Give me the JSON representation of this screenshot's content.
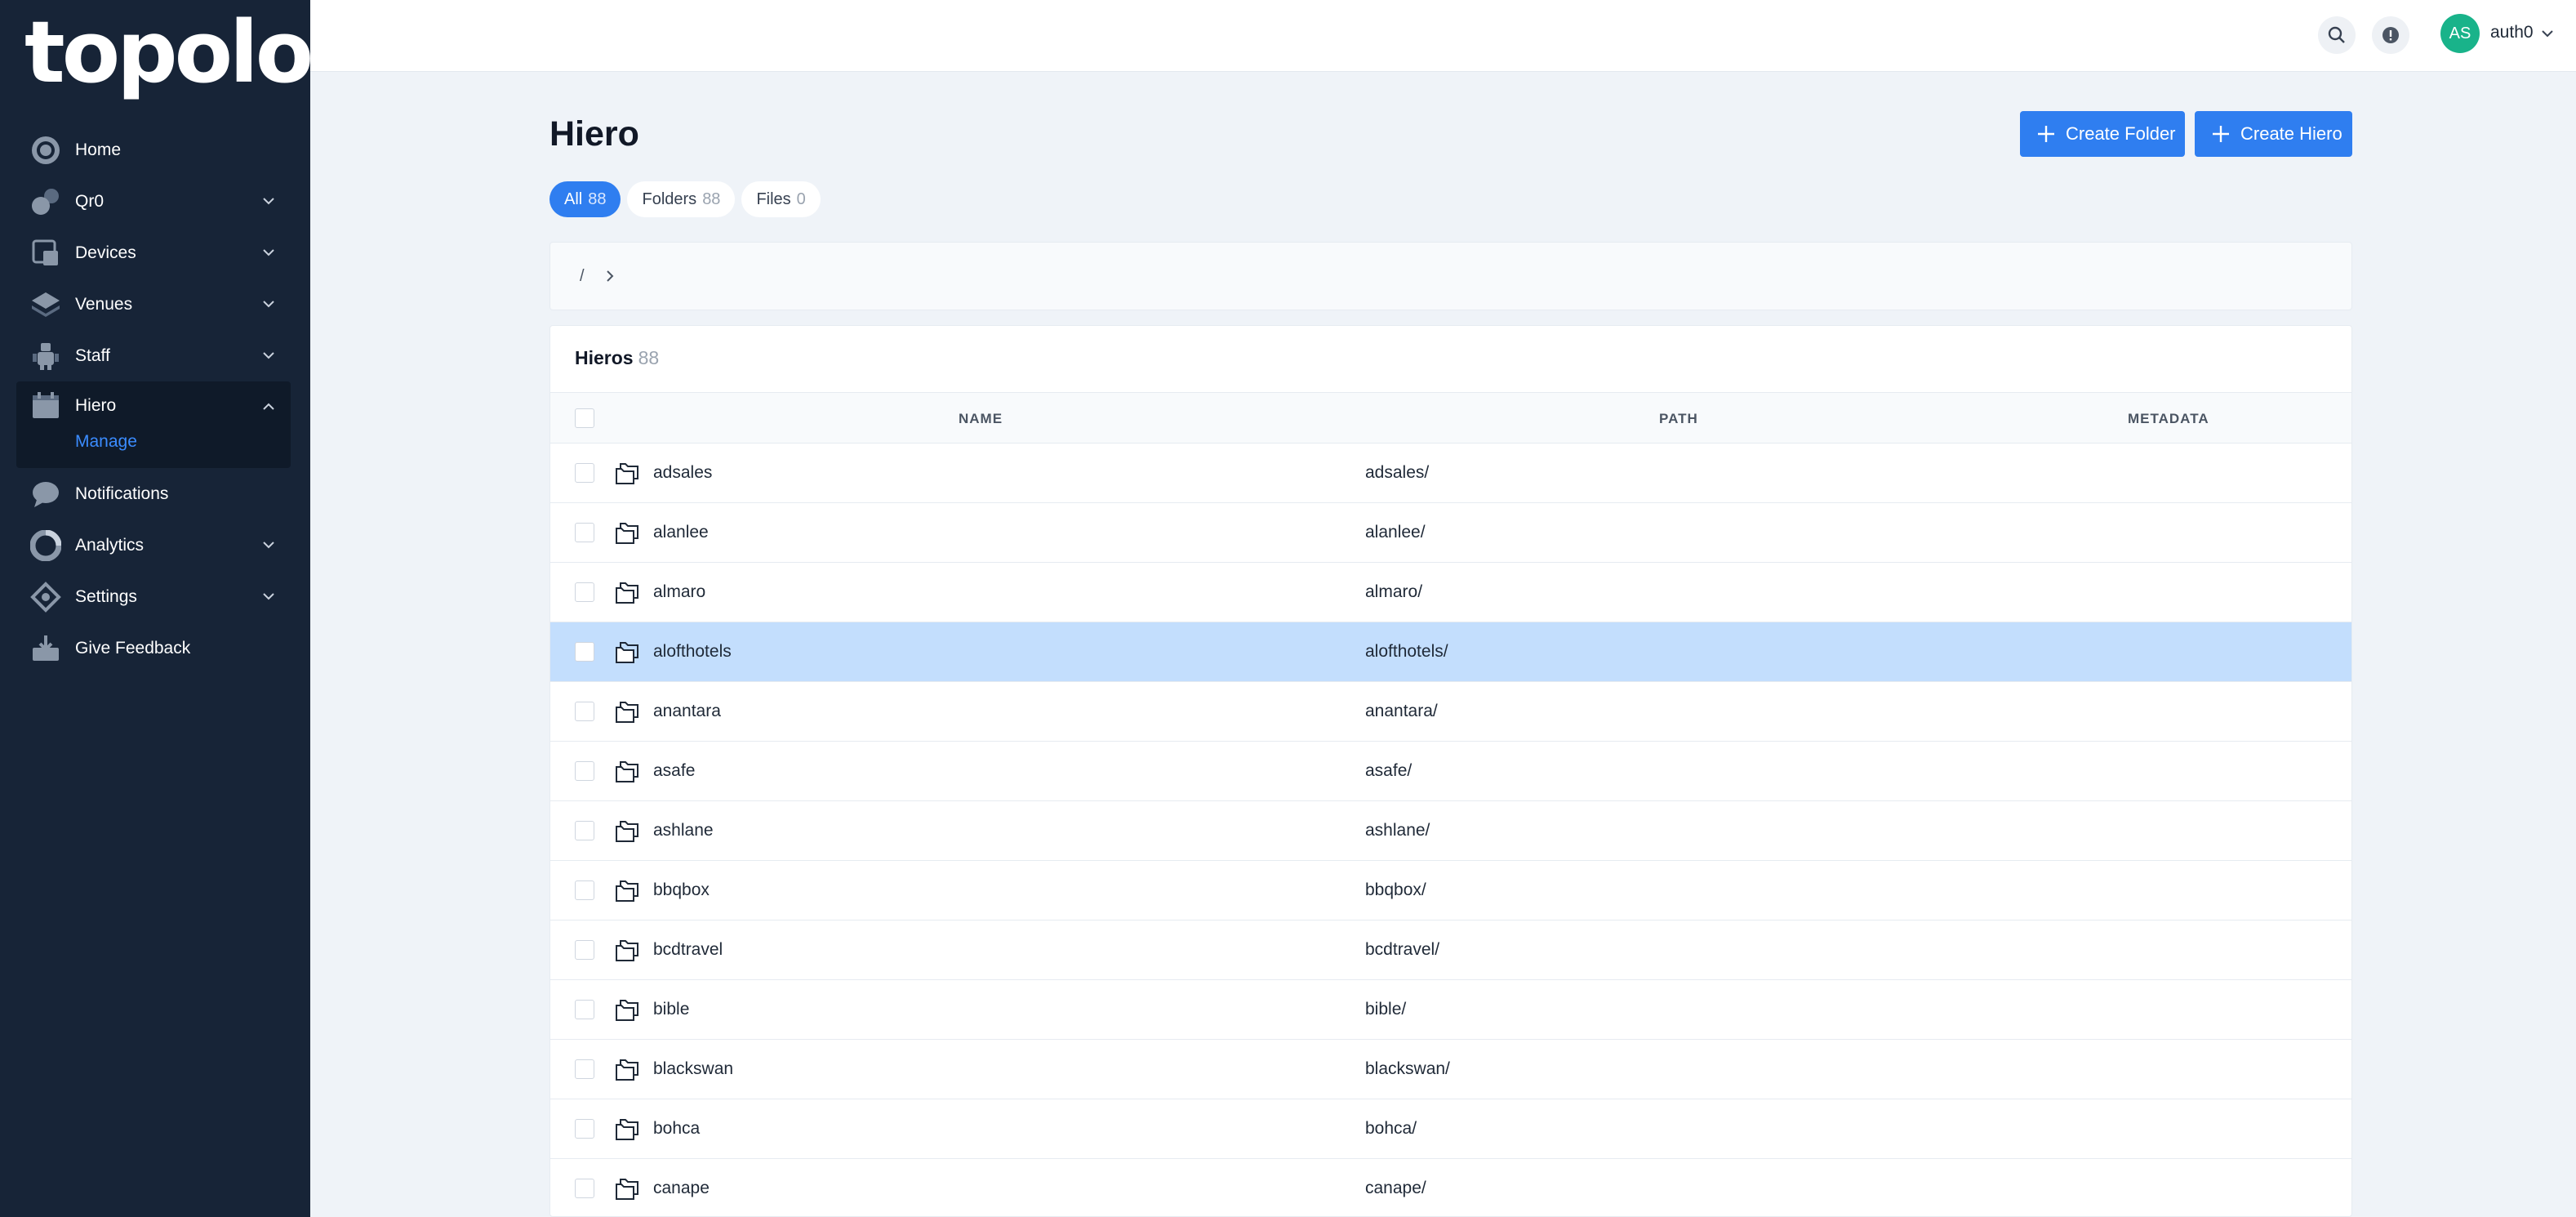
{
  "brand": {
    "logo_text": "topolo"
  },
  "sidebar": {
    "items": [
      {
        "label": "Home",
        "icon": "home-icon",
        "has_chevron": false
      },
      {
        "label": "Qr0",
        "icon": "qr-icon",
        "has_chevron": true
      },
      {
        "label": "Devices",
        "icon": "devices-icon",
        "has_chevron": true
      },
      {
        "label": "Venues",
        "icon": "venues-icon",
        "has_chevron": true
      },
      {
        "label": "Staff",
        "icon": "staff-icon",
        "has_chevron": true
      },
      {
        "label": "Hiero",
        "icon": "hiero-icon",
        "has_chevron": true,
        "expanded": true,
        "subitems": [
          {
            "label": "Manage",
            "active": true
          }
        ]
      },
      {
        "label": "Notifications",
        "icon": "chat-bubble-icon",
        "has_chevron": false
      },
      {
        "label": "Analytics",
        "icon": "analytics-icon",
        "has_chevron": true
      },
      {
        "label": "Settings",
        "icon": "settings-icon",
        "has_chevron": true
      },
      {
        "label": "Give Feedback",
        "icon": "feedback-inbox-icon",
        "has_chevron": false
      }
    ]
  },
  "topbar": {
    "search_icon": "search-icon",
    "alert_icon": "alert-icon",
    "avatar_initials": "AS",
    "user_name": "auth0"
  },
  "page": {
    "title": "Hiero",
    "create_folder_label": "Create Folder",
    "create_hiero_label": "Create Hiero"
  },
  "filters": [
    {
      "label": "All",
      "count": "88",
      "active": true
    },
    {
      "label": "Folders",
      "count": "88",
      "active": false
    },
    {
      "label": "Files",
      "count": "0",
      "active": false
    }
  ],
  "breadcrumb": {
    "root": "/"
  },
  "table": {
    "title": "Hieros",
    "count": "88",
    "columns": {
      "name": "NAME",
      "path": "PATH",
      "metadata": "METADATA"
    },
    "rows": [
      {
        "name": "adsales",
        "path": "adsales/"
      },
      {
        "name": "alanlee",
        "path": "alanlee/"
      },
      {
        "name": "almaro",
        "path": "almaro/"
      },
      {
        "name": "alofthotels",
        "path": "alofthotels/",
        "selected": true
      },
      {
        "name": "anantara",
        "path": "anantara/"
      },
      {
        "name": "asafe",
        "path": "asafe/"
      },
      {
        "name": "ashlane",
        "path": "ashlane/"
      },
      {
        "name": "bbqbox",
        "path": "bbqbox/"
      },
      {
        "name": "bcdtravel",
        "path": "bcdtravel/"
      },
      {
        "name": "bible",
        "path": "bible/"
      },
      {
        "name": "blackswan",
        "path": "blackswan/"
      },
      {
        "name": "bohca",
        "path": "bohca/"
      },
      {
        "name": "canape",
        "path": "canape/"
      }
    ]
  },
  "colors": {
    "sidebar_bg": "#172437",
    "accent": "#2f7ef0",
    "selected_row": "#c3defd",
    "avatar": "#19b38a",
    "page_bg": "#eff3f8"
  }
}
